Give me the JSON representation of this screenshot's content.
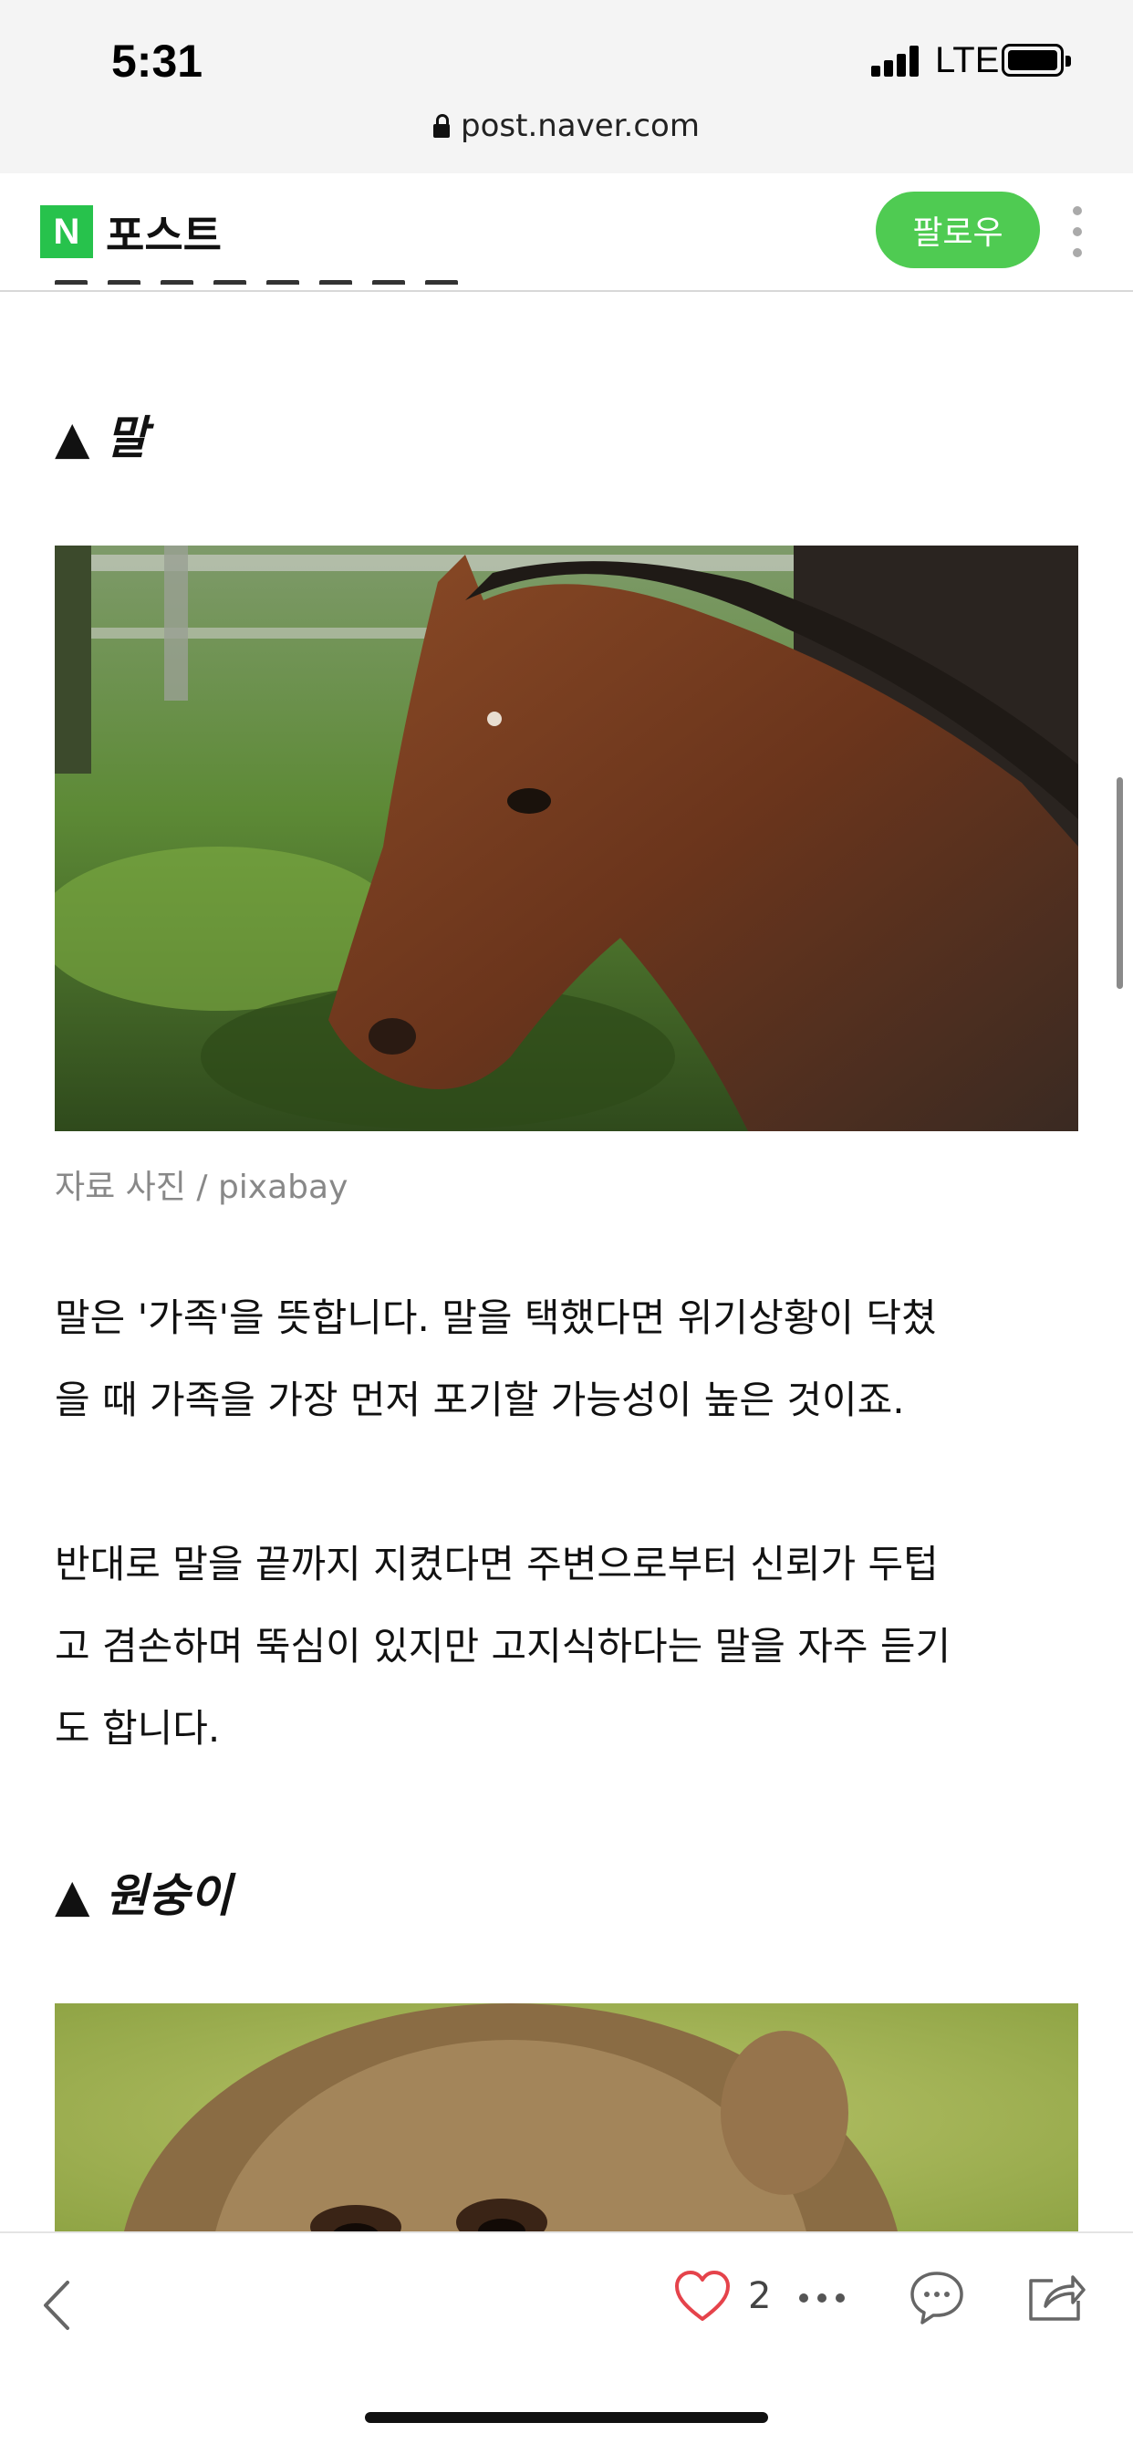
{
  "status": {
    "time": "5:31",
    "network": "LTE"
  },
  "browser": {
    "url": "post.naver.com"
  },
  "header": {
    "logo_letter": "N",
    "title": "포스트",
    "follow_label": "팔로우"
  },
  "article": {
    "section1": {
      "heading": "▲ 말",
      "image_alt": "말 사진",
      "caption": "자료 사진 / pixabay",
      "para1_line1": "말은 '가족'을 뜻합니다. 말을 택했다면 위기상황이 닥쳤",
      "para1_line2": "을 때 가족을 가장 먼저 포기할 가능성이 높은 것이죠.",
      "para2_line1": "반대로 말을 끝까지 지켰다면 주변으로부터 신뢰가 두텁",
      "para2_line2": "고 겸손하며 뚝심이 있지만 고지식하다는 말을 자주 듣기",
      "para2_line3": "도 합니다."
    },
    "section2": {
      "heading": "▲ 원숭이",
      "image_alt": "원숭이 사진"
    }
  },
  "bottom_bar": {
    "like_count": "2"
  },
  "colors": {
    "brand_green": "#27c24c",
    "follow_button": "#4fcb52",
    "like_heart": "#e5434b"
  }
}
